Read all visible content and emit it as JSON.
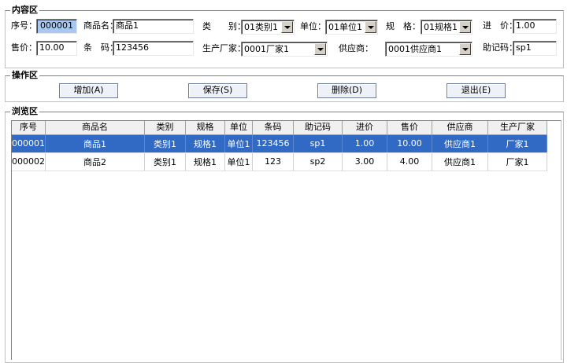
{
  "content": {
    "title": "内容区",
    "seq_label": "序号：",
    "seq_value": "000001",
    "name_label": "商品名：",
    "name_value": "商品1",
    "category_label": "类　　别：",
    "category_value": "01类别1",
    "unit_label": "单位：",
    "unit_value": "01单位1",
    "spec_label": "规　格：",
    "spec_value": "01规格1",
    "cost_label": "进　价：",
    "cost_value": "1.00",
    "price_label": "售价：",
    "price_value": "10.00",
    "barcode_label": "条　码：",
    "barcode_value": "123456",
    "maker_label": "生产厂家：",
    "maker_value": "0001厂家1",
    "supplier_label": "供应商：",
    "supplier_value": "0001供应商1",
    "mnemonic_label": "助记码：",
    "mnemonic_value": "sp1"
  },
  "ops": {
    "title": "操作区",
    "add_label": "增加(A)",
    "save_label": "保存(S)",
    "delete_label": "删除(D)",
    "exit_label": "退出(E)"
  },
  "browse": {
    "title": "浏览区",
    "columns": [
      "序号",
      "商品名",
      "类别",
      "规格",
      "单位",
      "条码",
      "助记码",
      "进价",
      "售价",
      "供应商",
      "生产厂家"
    ],
    "rows": [
      [
        "000001",
        "商品1",
        "类别1",
        "规格1",
        "单位1",
        "123456",
        "sp1",
        "1.00",
        "10.00",
        "供应商1",
        "厂家1"
      ],
      [
        "000002",
        "商品2",
        "类别1",
        "规格1",
        "单位1",
        "123",
        "sp2",
        "3.00",
        "4.00",
        "供应商1",
        "厂家1"
      ]
    ],
    "selected_row": 0
  }
}
